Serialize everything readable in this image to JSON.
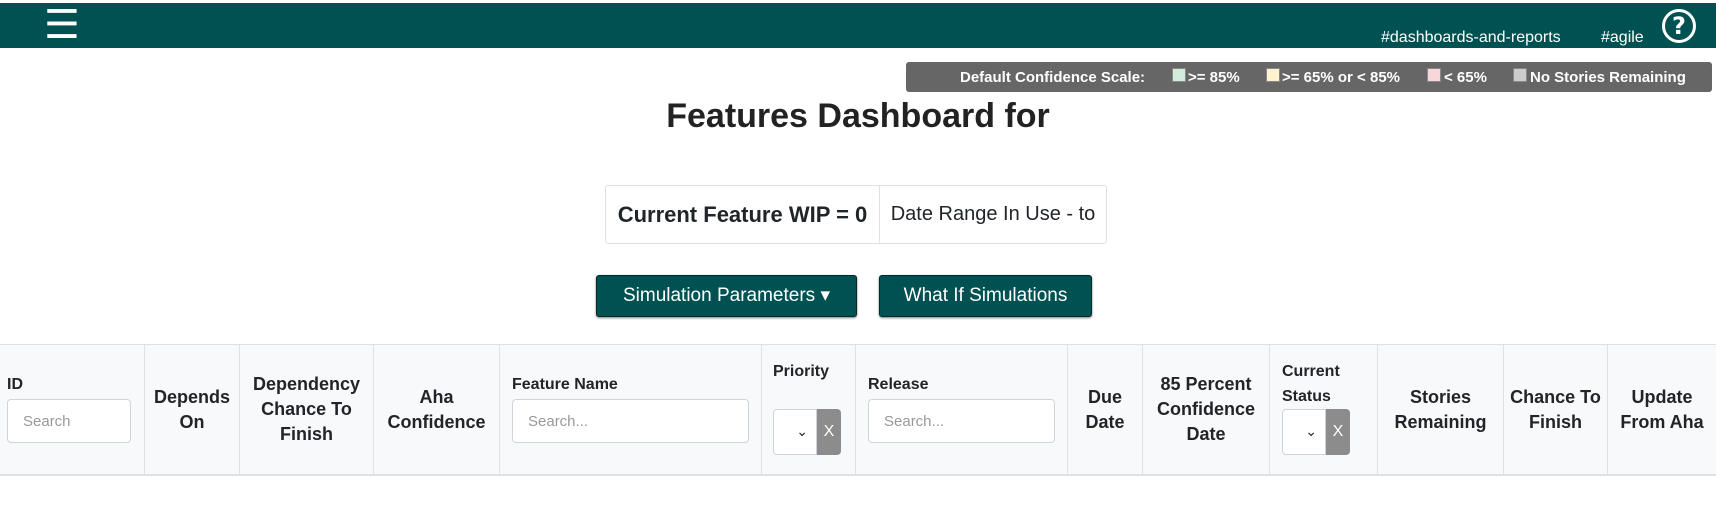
{
  "header": {
    "menu_icon": "hamburger-icon",
    "menu_glyph": "☰",
    "tags": [
      "#dashboards-and-reports",
      "#agile"
    ],
    "help_glyph": "?",
    "bg_color": "#005252"
  },
  "legend": {
    "label": "Default Confidence Scale:",
    "items": [
      {
        "label": ">= 85%",
        "color": "#d4edda"
      },
      {
        "label": ">= 65% or < 85%",
        "color": "#fff3cd"
      },
      {
        "label": "< 65%",
        "color": "#f8d7da"
      },
      {
        "label": "No Stories Remaining",
        "color": "#cccccc"
      }
    ]
  },
  "page": {
    "title": "Features Dashboard for",
    "wip_label": "Current Feature WIP = 0",
    "date_range_label": "Date Range In Use - to"
  },
  "buttons": {
    "simulation_parameters": "Simulation Parameters ▾",
    "what_if": "What If Simulations"
  },
  "table": {
    "columns": [
      {
        "key": "id",
        "label": "ID",
        "filter": "text",
        "placeholder": "Search"
      },
      {
        "key": "depends_on",
        "label": "Depends On"
      },
      {
        "key": "dependency_chance",
        "label": "Dependency Chance To Finish"
      },
      {
        "key": "aha_confidence",
        "label": "Aha Confidence"
      },
      {
        "key": "feature_name",
        "label": "Feature Name",
        "filter": "text",
        "placeholder": "Search..."
      },
      {
        "key": "priority",
        "label": "Priority",
        "filter": "select",
        "clear_label": "X"
      },
      {
        "key": "release",
        "label": "Release",
        "filter": "text",
        "placeholder": "Search..."
      },
      {
        "key": "due_date",
        "label": "Due Date"
      },
      {
        "key": "confidence_date",
        "label": "85 Percent Confidence Date"
      },
      {
        "key": "current_status",
        "label": "Current Status",
        "filter": "select",
        "clear_label": "X"
      },
      {
        "key": "stories_remaining",
        "label": "Stories Remaining"
      },
      {
        "key": "chance_to_finish",
        "label": "Chance To Finish"
      },
      {
        "key": "update_from_aha",
        "label": "Update From Aha"
      }
    ]
  }
}
